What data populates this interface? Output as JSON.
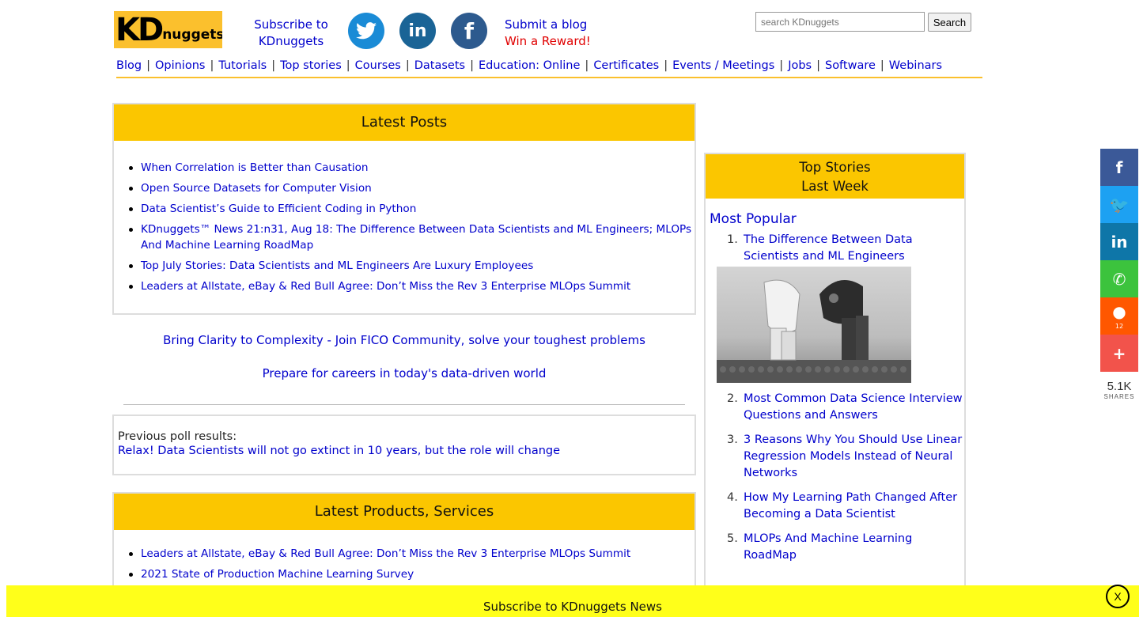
{
  "header": {
    "logo_main": "KD",
    "logo_sub": "nuggets",
    "logo_tm": "™",
    "subscribe_text": "Subscribe to KDnuggets",
    "social": {
      "twitter": "twitter-icon",
      "linkedin": "in",
      "facebook": "f"
    },
    "submit_blog": "Submit a blog",
    "win_reward": "Win a Reward!",
    "search_placeholder": "search KDnuggets",
    "search_button": "Search"
  },
  "nav": [
    "Blog",
    "Opinions",
    "Tutorials",
    "Top stories",
    "Courses",
    "Datasets",
    "Education: Online",
    "Certificates",
    "Events / Meetings",
    "Jobs",
    "Software",
    "Webinars"
  ],
  "latest_posts": {
    "title": "Latest Posts",
    "items": [
      "When Correlation is Better than Causation",
      "Open Source Datasets for Computer Vision",
      "Data Scientist’s Guide to Efficient Coding in Python",
      "KDnuggets™ News 21:n31, Aug 18: The Difference Between Data Scientists and ML Engineers; MLOPs And Machine Learning RoadMap",
      "Top July Stories: Data Scientists and ML Engineers Are Luxury Employees",
      "Leaders at Allstate, eBay & Red Bull Agree: Don’t Miss the Rev 3 Enterprise MLOps Summit"
    ]
  },
  "promos": [
    "Bring Clarity to Complexity - Join FICO Community, solve your toughest problems",
    "Prepare for careers in today's data-driven world"
  ],
  "poll": {
    "label": "Previous poll results:",
    "link": "Relax! Data Scientists will not go extinct in 10 years, but the role will change"
  },
  "products": {
    "title": "Latest Products, Services",
    "items": [
      "Leaders at Allstate, eBay & Red Bull Agree: Don’t Miss the Rev 3 Enterprise MLOps Summit",
      "2021 State of Production Machine Learning Survey"
    ]
  },
  "top_stories": {
    "title_line1": "Top Stories",
    "title_line2": "Last Week",
    "most_popular": "Most Popular",
    "items": [
      {
        "num": "1.",
        "text": "The Difference Between Data Scientists and ML Engineers"
      },
      {
        "num": "2.",
        "text": "Most Common Data Science Interview Questions and Answers"
      },
      {
        "num": "3.",
        "text": "3 Reasons Why You Should Use Linear Regression Models Instead of Neural Networks"
      },
      {
        "num": "4.",
        "text": "How My Learning Path Changed After Becoming a Data Scientist"
      },
      {
        "num": "5.",
        "text": "MLOPs And Machine Learning RoadMap"
      }
    ]
  },
  "share_bar": {
    "buttons": [
      {
        "icon": "facebook-icon",
        "glyph": "f",
        "color": "#3b5998"
      },
      {
        "icon": "twitter-icon",
        "glyph": "🐦",
        "color": "#1da1f2"
      },
      {
        "icon": "linkedin-icon",
        "glyph": "in",
        "color": "#0e76a8"
      },
      {
        "icon": "whatsapp-icon",
        "glyph": "✆",
        "color": "#3cc33d"
      },
      {
        "icon": "reddit-icon",
        "glyph": "●",
        "color": "#ff5700",
        "count": "12"
      },
      {
        "icon": "plus-icon",
        "glyph": "+",
        "color": "#f2534b"
      }
    ],
    "count": "5.1K",
    "count_label": "SHARES"
  },
  "bottom_bar": {
    "text": "Subscribe to KDnuggets News",
    "close": "X"
  },
  "colors": {
    "accent_yellow": "#fbc600",
    "link_blue": "#0000cc",
    "bar_yellow": "#ffff1a",
    "reward_red": "#e00000"
  }
}
